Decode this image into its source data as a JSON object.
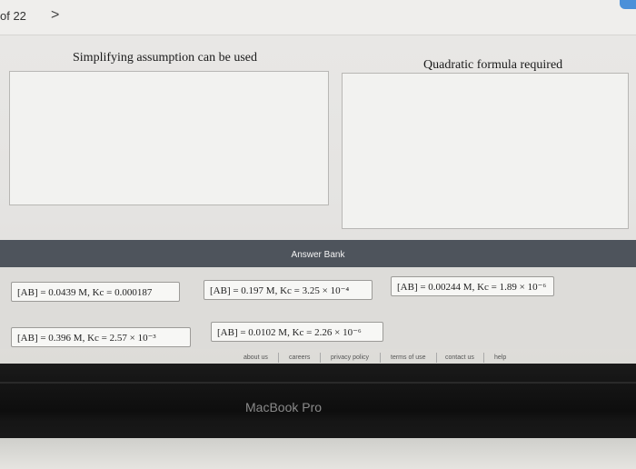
{
  "header": {
    "page_count": "of 22",
    "next_arrow": ">"
  },
  "zones": {
    "left_title": "Simplifying assumption can be used",
    "right_title": "Quadratic formula required"
  },
  "answer_bank": {
    "title": "Answer Bank",
    "items": [
      "[AB] = 0.0439 M, Kc = 0.000187",
      "[AB] = 0.197 M, Kc = 3.25 × 10⁻⁴",
      "[AB] = 0.00244 M, Kc = 1.89 × 10⁻⁶",
      "[AB] = 0.396 M, Kc = 2.57 × 10⁻³",
      "[AB] = 0.0102 M, Kc = 2.26 × 10⁻⁶"
    ]
  },
  "footer": {
    "links": [
      "about us",
      "careers",
      "privacy policy",
      "terms of use",
      "contact us",
      "help"
    ]
  },
  "device": {
    "label": "MacBook Pro"
  },
  "colors": {
    "bank_header": "#4e545c",
    "accent": "#4a90d9"
  }
}
